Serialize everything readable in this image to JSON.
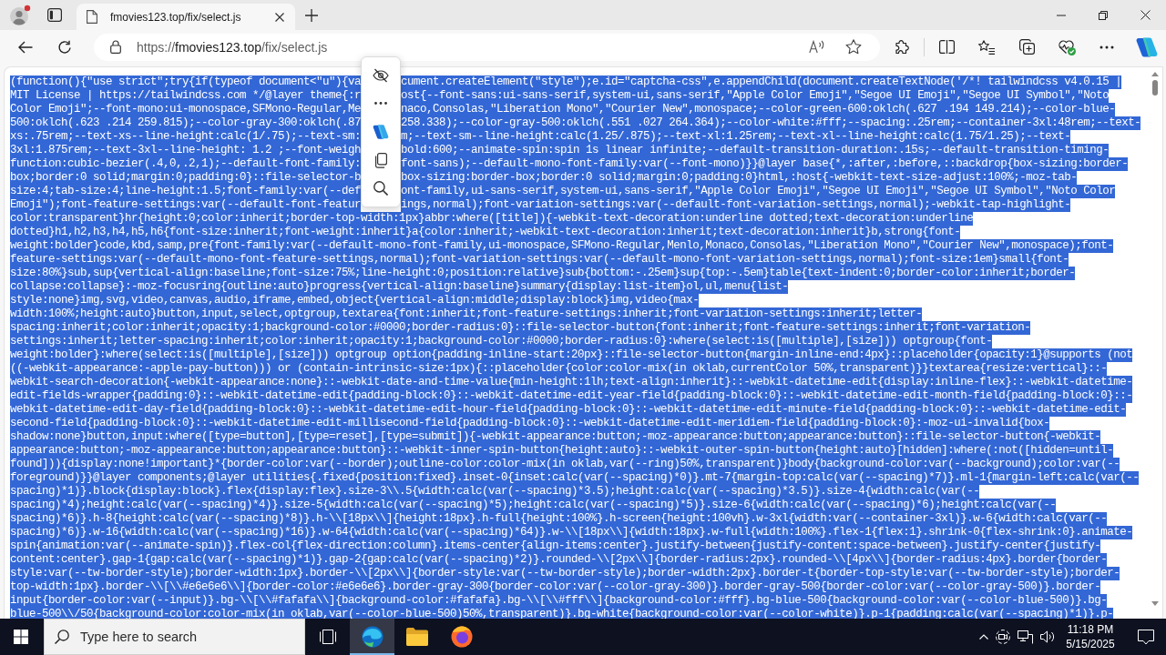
{
  "browser": {
    "tabs": [
      {
        "title": "fmovies123.top/fix/select.js",
        "selected": true
      }
    ],
    "address_bar": {
      "url_scheme": "https://",
      "url_host": "fmovies123.top",
      "url_path": "/fix/select.js"
    }
  },
  "document": {
    "lines": [
      {
        "kind": "covered",
        "left": "(function(){\"use strict\";try{if(typeof document<\"u\"){va",
        "right": "cument.createElement(\"style\");e.id=\"captcha-css\",e.appendChild(document.createTextNode('/*! tailwindcss v4.0.15 |",
        "selected": true
      },
      {
        "kind": "covered",
        "left": "MIT License | https://tailwindcss.com */@layer theme{:r",
        "right": "ost{--font-sans:ui-sans-serif,system-ui,sans-serif,\"Apple Color Emoji\",\"Segoe UI Emoji\",\"Segoe UI Symbol\",\"Noto",
        "selected": true
      },
      {
        "kind": "covered",
        "left": "Color Emoji\";--font-mono:ui-monospace,SFMono-Regular,Me",
        "right": "naco,Consolas,\"Liberation Mono\",\"Courier New\",monospace;--color-green-600:oklch(.627 .194 149.214);--color-blue-",
        "selected": true
      },
      {
        "kind": "covered",
        "left": "500:oklch(.623 .214 259.815);--color-gray-300:oklch(.87",
        "right": "258.338);--color-gray-500:oklch(.551 .027 264.364);--color-white:#fff;--spacing:.25rem;--container-3xl:48rem;--text-",
        "selected": true
      },
      {
        "kind": "covered",
        "left": "xs:.75rem;--text-xs--line-height:calc(1/.75);--text-sm:",
        "right": "m;--text-sm--line-height:calc(1.25/.875);--text-xl:1.25rem;--text-xl--line-height:calc(1.75/1.25);--text-",
        "selected": true
      },
      {
        "kind": "covered",
        "left": "3xl:1.875rem;--text-3xl--line-height: 1.2 ;--font-weigh",
        "right": "bold:600;--animate-spin:spin 1s linear infinite;--default-transition-duration:.15s;--default-transition-timing-",
        "selected": true
      },
      {
        "kind": "covered",
        "left": "function:cubic-bezier(.4,0,.2,1);--default-font-family:",
        "right": "font-sans);--default-mono-font-family:var(--font-mono)}}@layer base{*,:after,:before,::backdrop{box-sizing:border-",
        "selected": true
      },
      {
        "kind": "covered",
        "left": "box;border:0 solid;margin:0;padding:0}::file-selector-b",
        "right": "box-sizing:border-box;border:0 solid;margin:0;padding:0}html,:host{-webkit-text-size-adjust:100%;-moz-tab-",
        "selected": true
      },
      {
        "kind": "covered",
        "left": "size:4;tab-size:4;line-height:1.5;font-family:var(--def",
        "right": "ont-family,ui-sans-serif,system-ui,sans-serif,\"Apple Color Emoji\",\"Segoe UI Emoji\",\"Segoe UI Symbol\",\"Noto Color",
        "selected": true
      },
      {
        "kind": "covered",
        "left": "Emoji\");font-feature-settings:var(--default-font-featur",
        "right": "ings,normal);font-variation-settings:var(--default-font-variation-settings,normal);-webkit-tap-highlight-",
        "selected": true
      },
      {
        "kind": "plain",
        "text": "color:transparent}hr{height:0;color:inherit;border-top-width:1px}abbr:where([title]){-webkit-text-decoration:underline dotted;text-decoration:underline",
        "selected": true
      },
      {
        "kind": "plain",
        "text": "dotted}h1,h2,h3,h4,h5,h6{font-size:inherit;font-weight:inherit}a{color:inherit;-webkit-text-decoration:inherit;text-decoration:inherit}b,strong{font-",
        "selected": true
      },
      {
        "kind": "plain",
        "text": "weight:bolder}code,kbd,samp,pre{font-family:var(--default-mono-font-family,ui-monospace,SFMono-Regular,Menlo,Monaco,Consolas,\"Liberation Mono\",\"Courier New\",monospace);font-",
        "selected": true
      },
      {
        "kind": "plain",
        "text": "feature-settings:var(--default-mono-font-feature-settings,normal);font-variation-settings:var(--default-mono-font-variation-settings,normal);font-size:1em}small{font-",
        "selected": true
      },
      {
        "kind": "plain",
        "text": "size:80%}sub,sup{vertical-align:baseline;font-size:75%;line-height:0;position:relative}sub{bottom:-.25em}sup{top:-.5em}table{text-indent:0;border-color:inherit;border-",
        "selected": true
      },
      {
        "kind": "plain",
        "text": "collapse:collapse}:-moz-focusring{outline:auto}progress{vertical-align:baseline}summary{display:list-item}ol,ul,menu{list-",
        "selected": true
      },
      {
        "kind": "plain",
        "text": "style:none}img,svg,video,canvas,audio,iframe,embed,object{vertical-align:middle;display:block}img,video{max-",
        "selected": true
      },
      {
        "kind": "plain",
        "text": "width:100%;height:auto}button,input,select,optgroup,textarea{font:inherit;font-feature-settings:inherit;font-variation-settings:inherit;letter-",
        "selected": true
      },
      {
        "kind": "plain",
        "text": "spacing:inherit;color:inherit;opacity:1;background-color:#0000;border-radius:0}::file-selector-button{font:inherit;font-feature-settings:inherit;font-variation-",
        "selected": true
      },
      {
        "kind": "plain",
        "text": "settings:inherit;letter-spacing:inherit;color:inherit;opacity:1;background-color:#0000;border-radius:0}:where(select:is([multiple],[size])) optgroup{font-",
        "selected": true
      },
      {
        "kind": "plain",
        "text": "weight:bolder}:where(select:is([multiple],[size])) optgroup option{padding-inline-start:20px}::file-selector-button{margin-inline-end:4px}::placeholder{opacity:1}@supports (not",
        "selected": true
      },
      {
        "kind": "plain",
        "text": "((-webkit-appearance:-apple-pay-button))) or (contain-intrinsic-size:1px){::placeholder{color:color-mix(in oklab,currentColor 50%,transparent)}}textarea{resize:vertical}::-",
        "selected": true
      },
      {
        "kind": "plain",
        "text": "webkit-search-decoration{-webkit-appearance:none}::-webkit-date-and-time-value{min-height:1lh;text-align:inherit}::-webkit-datetime-edit{display:inline-flex}::-webkit-datetime-",
        "selected": true
      },
      {
        "kind": "plain",
        "text": "edit-fields-wrapper{padding:0}::-webkit-datetime-edit{padding-block:0}::-webkit-datetime-edit-year-field{padding-block:0}::-webkit-datetime-edit-month-field{padding-block:0}::-",
        "selected": true
      },
      {
        "kind": "plain",
        "text": "webkit-datetime-edit-day-field{padding-block:0}::-webkit-datetime-edit-hour-field{padding-block:0}::-webkit-datetime-edit-minute-field{padding-block:0}::-webkit-datetime-edit-",
        "selected": true
      },
      {
        "kind": "plain",
        "text": "second-field{padding-block:0}::-webkit-datetime-edit-millisecond-field{padding-block:0}::-webkit-datetime-edit-meridiem-field{padding-block:0}:-moz-ui-invalid{box-",
        "selected": true
      },
      {
        "kind": "plain",
        "text": "shadow:none}button,input:where([type=button],[type=reset],[type=submit]){-webkit-appearance:button;-moz-appearance:button;appearance:button}::file-selector-button{-webkit-",
        "selected": true
      },
      {
        "kind": "plain",
        "text": "appearance:button;-moz-appearance:button;appearance:button}::-webkit-inner-spin-button{height:auto}::-webkit-outer-spin-button{height:auto}[hidden]:where(:not([hidden=until-",
        "selected": true
      },
      {
        "kind": "plain",
        "text": "found])){display:none!important}*{border-color:var(--border);outline-color:color-mix(in oklab,var(--ring)50%,transparent)}body{background-color:var(--background);color:var(--",
        "selected": true
      },
      {
        "kind": "plain",
        "text": "foreground)}}@layer components;@layer utilities{.fixed{position:fixed}.inset-0{inset:calc(var(--spacing)*0)}.mt-7{margin-top:calc(var(--spacing)*7)}.ml-1{margin-left:calc(var(--",
        "selected": true
      },
      {
        "kind": "plain",
        "text": "spacing)*1)}.block{display:block}.flex{display:flex}.size-3\\\\.5{width:calc(var(--spacing)*3.5);height:calc(var(--spacing)*3.5)}.size-4{width:calc(var(--",
        "selected": true
      },
      {
        "kind": "plain",
        "text": "spacing)*4);height:calc(var(--spacing)*4)}.size-5{width:calc(var(--spacing)*5);height:calc(var(--spacing)*5)}.size-6{width:calc(var(--spacing)*6);height:calc(var(--",
        "selected": true
      },
      {
        "kind": "plain",
        "text": "spacing)*6)}.h-8{height:calc(var(--spacing)*8)}.h-\\\\[18px\\\\]{height:18px}.h-full{height:100%}.h-screen{height:100vh}.w-3xl{width:var(--container-3xl)}.w-6{width:calc(var(--",
        "selected": true
      },
      {
        "kind": "plain",
        "text": "spacing)*6)}.w-16{width:calc(var(--spacing)*16)}.w-64{width:calc(var(--spacing)*64)}.w-\\\\[18px\\\\]{width:18px}.w-full{width:100%}.flex-1{flex:1}.shrink-0{flex-shrink:0}.animate-",
        "selected": true
      },
      {
        "kind": "plain",
        "text": "spin{animation:var(--animate-spin)}.flex-col{flex-direction:column}.items-center{align-items:center}.justify-between{justify-content:space-between}.justify-center{justify-",
        "selected": true
      },
      {
        "kind": "plain",
        "text": "content:center}.gap-1{gap:calc(var(--spacing)*1)}.gap-2{gap:calc(var(--spacing)*2)}.rounded-\\\\[2px\\\\]{border-radius:2px}.rounded-\\\\[4px\\\\]{border-radius:4px}.border{border-",
        "selected": true
      },
      {
        "kind": "plain",
        "text": "style:var(--tw-border-style);border-width:1px}.border-\\\\[2px\\\\]{border-style:var(--tw-border-style);border-width:2px}.border-t{border-top-style:var(--tw-border-style);border-",
        "selected": true
      },
      {
        "kind": "plain",
        "text": "top-width:1px}.border-\\\\[\\\\#e6e6e6\\\\]{border-color:#e6e6e6}.border-gray-300{border-color:var(--color-gray-300)}.border-gray-500{border-color:var(--color-gray-500)}.border-",
        "selected": true
      },
      {
        "kind": "plain",
        "text": "input{border-color:var(--input)}.bg-\\\\[\\\\#fafafa\\\\]{background-color:#fafafa}.bg-\\\\[\\\\#fff\\\\]{background-color:#fff}.bg-blue-500{background-color:var(--color-blue-500)}.bg-",
        "selected": true
      },
      {
        "kind": "plain",
        "text": "blue-500\\\\/50{background-color:color-mix(in oklab,var(--color-blue-500)50%,transparent)}.bg-white{background-color:var(--color-white)}.p-1{padding:calc(var(--spacing)*1)}.p-",
        "selected": true
      }
    ]
  },
  "taskbar": {
    "search": {
      "placeholder": "Type here to search"
    },
    "apps": [
      {
        "kind": "task-view",
        "selected": false
      },
      {
        "kind": "browser",
        "selected": true
      },
      {
        "kind": "folder",
        "selected": false
      },
      {
        "kind": "fox-browser",
        "selected": false
      }
    ],
    "clock": {
      "time": "11:18 PM",
      "date": "5/15/2025"
    }
  }
}
